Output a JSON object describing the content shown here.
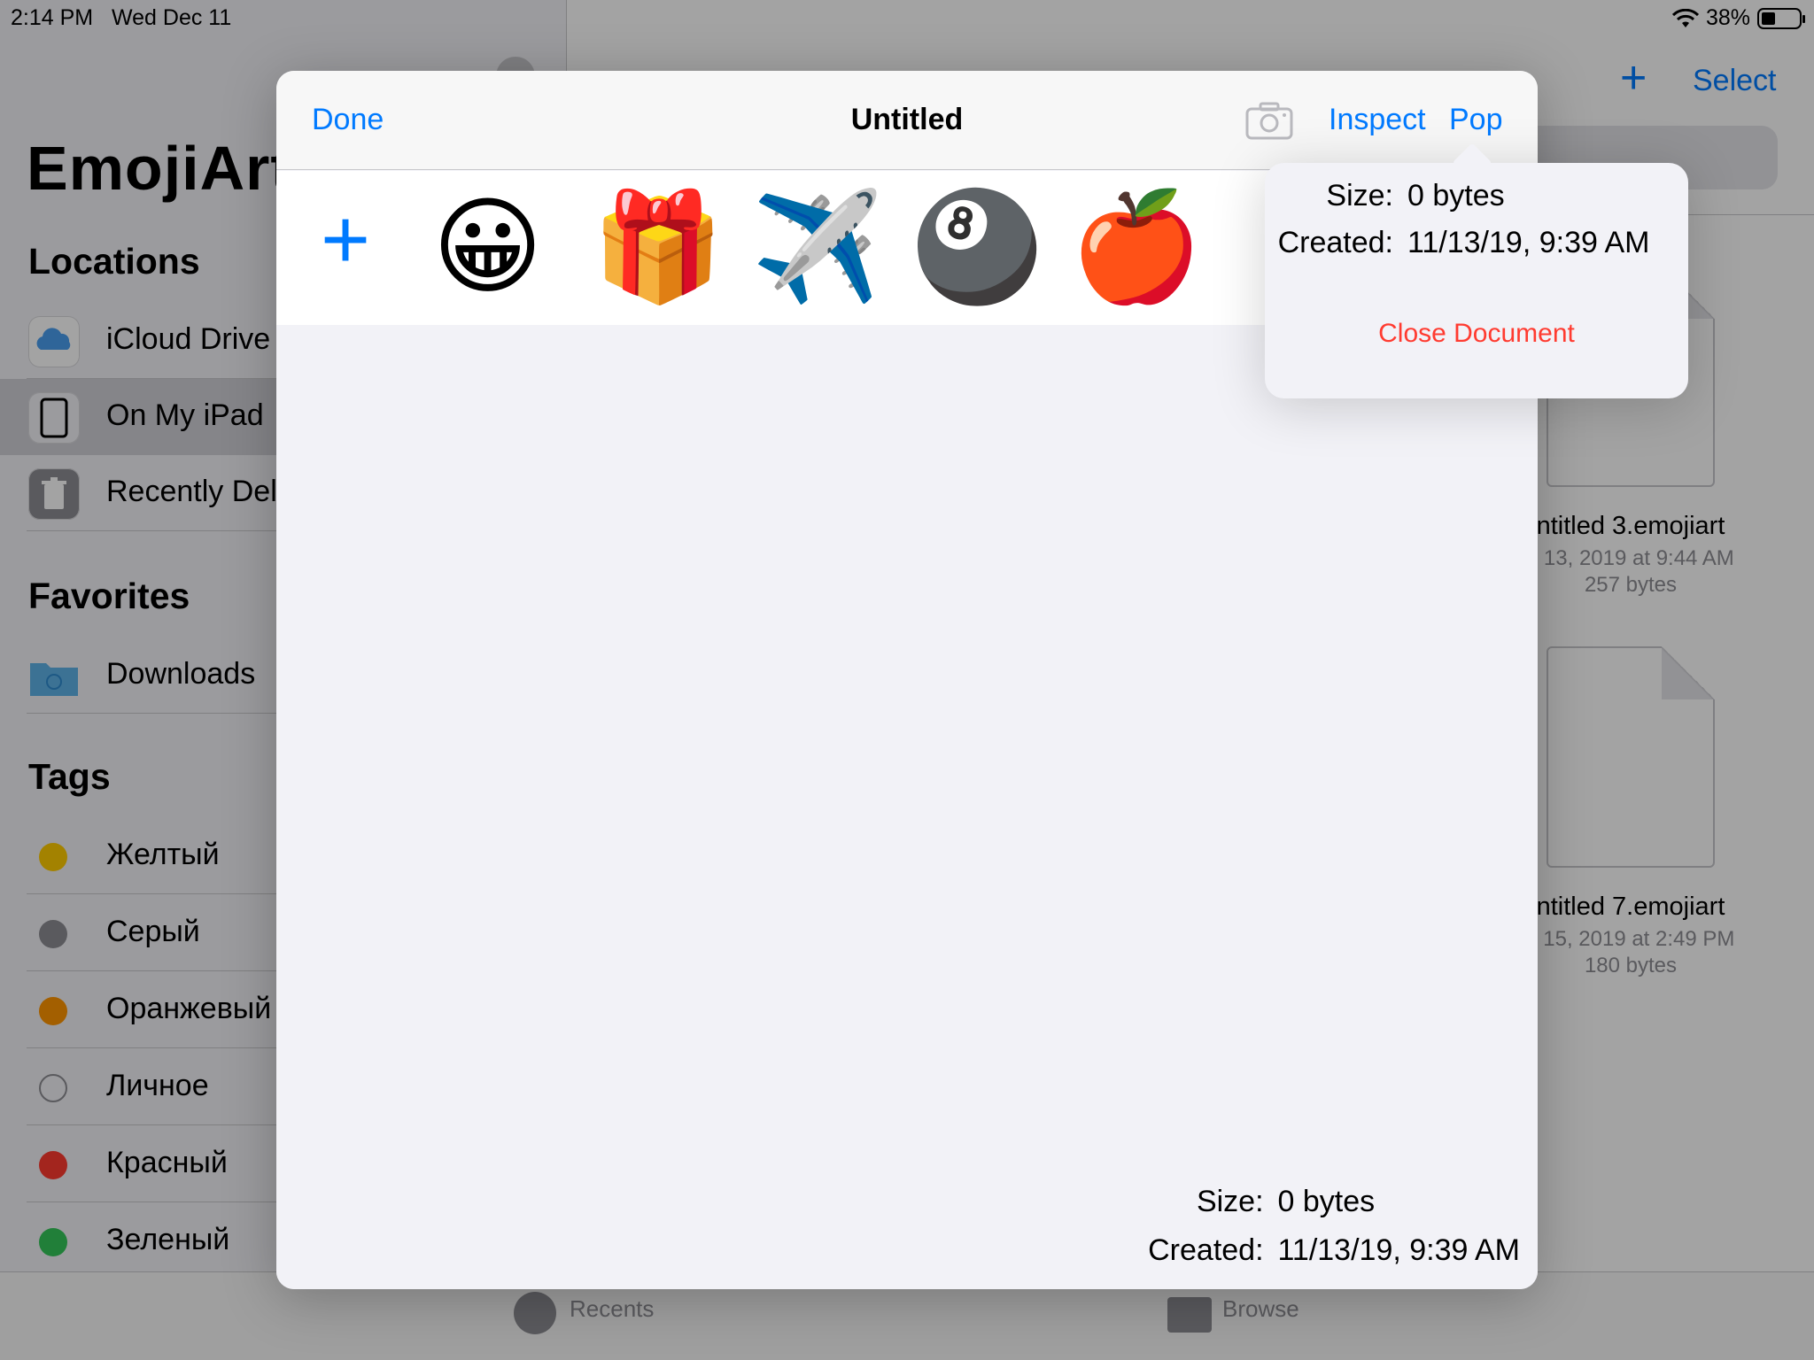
{
  "status_bar": {
    "time": "2:14 PM",
    "date": "Wed Dec 11",
    "battery_text": "38%",
    "battery_level": 0.38
  },
  "sidebar": {
    "app_title": "EmojiArt",
    "locations_header": "Locations",
    "locations": [
      {
        "label": "iCloud Drive",
        "icon": "icloud-icon"
      },
      {
        "label": "On My iPad",
        "icon": "ipad-icon"
      },
      {
        "label": "Recently Del",
        "icon": "trash-icon"
      }
    ],
    "favorites_header": "Favorites",
    "favorites": [
      {
        "label": "Downloads",
        "icon": "folder-download-icon"
      }
    ],
    "tags_header": "Tags",
    "tags": [
      {
        "label": "Желтый",
        "color": "#ffcc00"
      },
      {
        "label": "Серый",
        "color": "#8e8e93"
      },
      {
        "label": "Оранжевый",
        "color": "#ff9500"
      },
      {
        "label": "Личное",
        "color": ""
      },
      {
        "label": "Красный",
        "color": "#ff3b30"
      },
      {
        "label": "Зеленый",
        "color": "#34c759"
      }
    ]
  },
  "browser": {
    "nav_select": "Select",
    "files": [
      {
        "name": "ntitled 3.emojiart",
        "date": "v 13, 2019 at 9:44 AM",
        "size": "257 bytes"
      },
      {
        "name": "ntitled 7.emojiart",
        "date": "v 15, 2019 at 2:49 PM",
        "size": "180 bytes"
      }
    ]
  },
  "tab_bar": {
    "recents": "Recents",
    "browse": "Browse"
  },
  "document": {
    "done": "Done",
    "title": "Untitled",
    "inspect": "Inspect",
    "pop": "Pop",
    "add_symbol": "+",
    "emojis": [
      "😀",
      "🎁",
      "✈️",
      "🎱",
      "🍎"
    ],
    "info": {
      "size_label": "Size:",
      "size_value": "0 bytes",
      "created_label": "Created:",
      "created_value": "11/13/19, 9:39 AM"
    }
  },
  "popover": {
    "size_label": "Size:",
    "size_value": "0 bytes",
    "created_label": "Created:",
    "created_value": "11/13/19, 9:39 AM",
    "close": "Close Document"
  },
  "colors": {
    "accent": "#007aff",
    "destructive": "#ff3b30"
  }
}
